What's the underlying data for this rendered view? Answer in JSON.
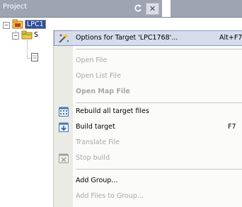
{
  "pane": {
    "title": "Project",
    "pin_glyph": "↻",
    "close_glyph": "✕"
  },
  "tree": {
    "root_expander": "−",
    "root_label": "LPC1",
    "child_expander": "−",
    "child_label": "S"
  },
  "menu": {
    "items": [
      {
        "label": "Options for Target 'LPC1768'...",
        "shortcut": "Alt+F7",
        "icon": "magic-wand-icon"
      },
      {
        "label": "Open File"
      },
      {
        "label": "Open List File"
      },
      {
        "label": "Open Map File"
      },
      {
        "label": "Rebuild all target files",
        "icon": "rebuild-icon"
      },
      {
        "label": "Build target",
        "shortcut": "F7",
        "icon": "build-icon"
      },
      {
        "label": "Translate File"
      },
      {
        "label": "Stop build",
        "icon": "stop-build-icon"
      },
      {
        "label": "Add Group..."
      },
      {
        "label": "Add Files to Group..."
      }
    ]
  },
  "colors": {
    "titlebar": "#9ea4b0",
    "menu_highlight": "#d6dcec",
    "disabled_text": "#a7a7a7"
  }
}
